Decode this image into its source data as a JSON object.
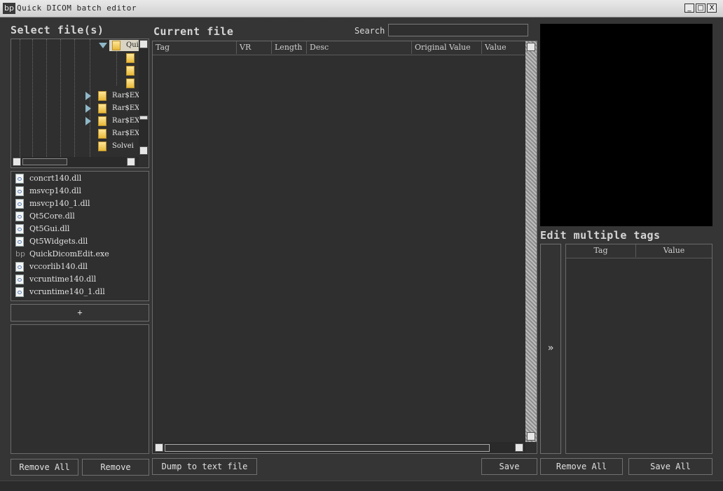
{
  "window": {
    "icon_text": "bp",
    "title": "Quick DICOM batch editor",
    "controls": [
      "_",
      "□",
      "X"
    ]
  },
  "left": {
    "title": "Select file(s)",
    "tree": [
      {
        "label": "Qui",
        "expanded": true,
        "selected": true
      },
      {
        "label": ""
      },
      {
        "label": ""
      },
      {
        "label": ""
      },
      {
        "label": "Rar$EX",
        "collapsed": true
      },
      {
        "label": "Rar$EX",
        "collapsed": true
      },
      {
        "label": "Rar$EX",
        "collapsed": true
      },
      {
        "label": "Rar$EX"
      },
      {
        "label": "Solvei"
      }
    ],
    "files": [
      {
        "name": "concrt140.dll",
        "icon": "dll-icon"
      },
      {
        "name": "msvcp140.dll",
        "icon": "dll-icon"
      },
      {
        "name": "msvcp140_1.dll",
        "icon": "dll-icon"
      },
      {
        "name": "Qt5Core.dll",
        "icon": "dll-icon"
      },
      {
        "name": "Qt5Gui.dll",
        "icon": "dll-icon"
      },
      {
        "name": "Qt5Widgets.dll",
        "icon": "dll-icon"
      },
      {
        "name": "QuickDicomEdit.exe",
        "icon": "bp"
      },
      {
        "name": "vccorlib140.dll",
        "icon": "dll-icon"
      },
      {
        "name": "vcruntime140.dll",
        "icon": "dll-icon"
      },
      {
        "name": "vcruntime140_1.dll",
        "icon": "dll-icon"
      }
    ],
    "add_label": "+",
    "remove_all_label": "Remove All",
    "remove_label": "Remove"
  },
  "center": {
    "title": "Current file",
    "search_label": "Search",
    "search_value": "",
    "columns": [
      "Tag",
      "VR",
      "Length",
      "Desc",
      "Original Value",
      "Value"
    ],
    "dump_label": "Dump to text file",
    "save_label": "Save"
  },
  "right": {
    "multi_title": "Edit multiple tags",
    "transfer_label": "»",
    "columns": [
      "Tag",
      "Value"
    ],
    "remove_all_label": "Remove All",
    "save_all_label": "Save All"
  }
}
